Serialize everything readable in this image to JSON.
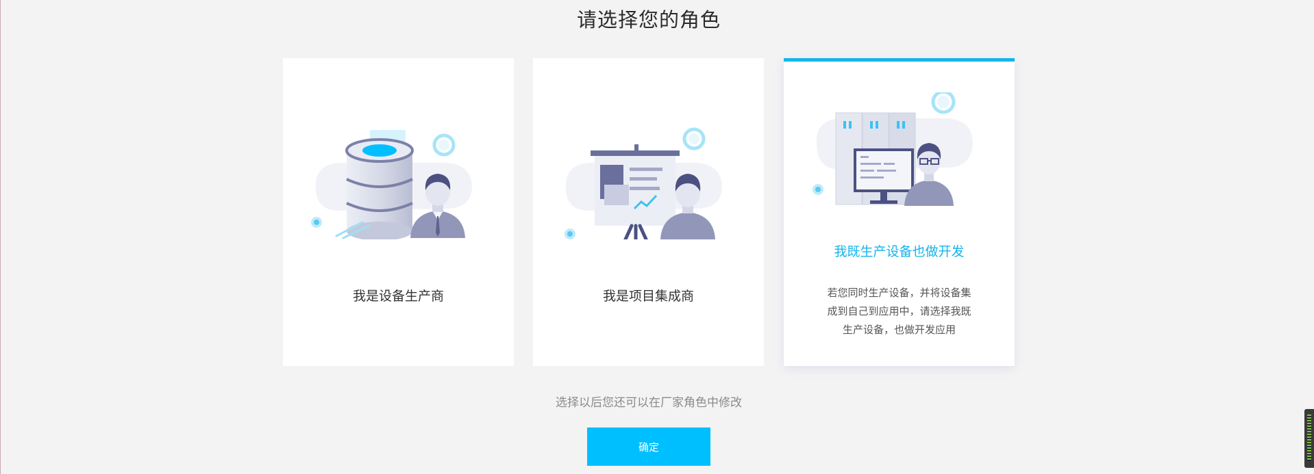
{
  "page": {
    "title": "请选择您的角色",
    "hint": "选择以后您还可以在厂家角色中修改",
    "confirm_label": "确定"
  },
  "roles": [
    {
      "label": "我是设备生产商",
      "icon": "database-user-icon",
      "selected": false
    },
    {
      "label": "我是项目集成商",
      "icon": "presentation-user-icon",
      "selected": false
    },
    {
      "label": "我既生产设备也做开发",
      "icon": "server-developer-icon",
      "selected": true,
      "description": "若您同时生产设备，并将设备集成到自己到应用中，请选择我既生产设备，也做开发应用"
    }
  ],
  "colors": {
    "accent": "#13b5ea",
    "button": "#00bfff",
    "background": "#f3f3f3"
  }
}
